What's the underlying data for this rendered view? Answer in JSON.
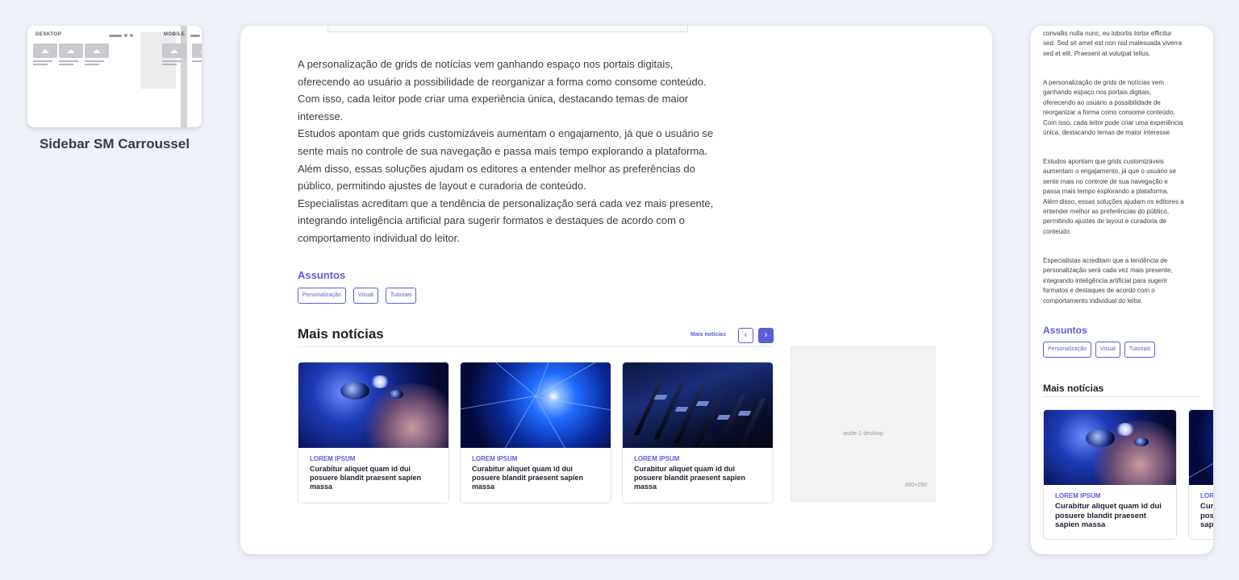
{
  "thumbnail": {
    "desktop_label": "DESKTOP",
    "mobile_label": "MOBILE",
    "caption": "Sidebar SM Carroussel"
  },
  "article": {
    "paragraph": "A personalização de grids de notícias vem ganhando espaço nos portais digitais,\noferecendo ao usuário a possibilidade de reorganizar a forma como consome conteúdo.\nCom isso, cada leitor pode criar uma experiência única, destacando temas de maior\ninteresse.\n Estudos apontam que grids customizáveis aumentam o engajamento, já que o usuário se\nsente mais no controle de sua navegação e passa mais tempo explorando a plataforma.\n Além disso, essas soluções ajudam os editores a entender melhor as preferências do\npúblico, permitindo ajustes de layout e curadoria de conteúdo.\nEspecialistas acreditam que a tendência de personalização será cada vez mais presente,\nintegrando inteligência artificial para sugerir formatos e destaques de acordo com o\ncomportamento individual do leitor."
  },
  "assuntos": {
    "title": "Assuntos",
    "tags": [
      "Personalização",
      "Visual",
      "Tutoriais"
    ]
  },
  "mais_noticias": {
    "title": "Mais notícias",
    "link": "Mais notícias",
    "prev_icon": "‹",
    "next_icon": "›",
    "cards": [
      {
        "category": "LOREM IPSUM",
        "title": "Curabitur aliquet quam id dui posuere blandit praesent sapien massa"
      },
      {
        "category": "LOREM IPSUM",
        "title": "Curabitur aliquet quam id dui posuere blandit praesent sapien massa"
      },
      {
        "category": "LOREM IPSUM",
        "title": "Curabitur aliquet quam id dui posuere blandit praesent sapien massa"
      }
    ]
  },
  "aside": {
    "name": "aside-1-desktop",
    "size": "300×250"
  },
  "mobile": {
    "para0": "convallis nulla nunc, eu lobortis tortor efficitur\nsed. Sed sit amet est non nisl malesuada viverra\nsed et elit. Praesent at volutpat tellus.",
    "para1": "A personalização de grids de notícias vem\nganhando espaço nos portais digitais,\noferecendo ao usuário a possibilidade de\nreorganizar a forma como consome conteúdo.\nCom isso, cada leitor pode criar uma experiência\núnica, destacando temas de maior interesse.",
    "para2": "Estudos apontam que grids customizáveis\naumentam o engajamento, já que o usuário se\nsente mais no controle de sua navegação e\npassa mais tempo explorando a plataforma.\n Além disso, essas soluções ajudam os editores a\nentender melhor as preferências do público,\npermitindo ajustes de layout e curadoria de\nconteúdo.",
    "para3": "Especialistas acreditam que a tendência de\npersonalização será cada vez mais presente,\nintegrando inteligência artificial para sugerir\nformatos e destaques de acordo com o\ncomportamento individual do leitor.",
    "assuntos_title": "Assuntos",
    "tags": [
      "Personalização",
      "Visual",
      "Tutoriais"
    ],
    "mais_title": "Mais notícias",
    "cards": [
      {
        "category": "LOREM IPSUM",
        "title": "Curabitur aliquet quam id dui posuere blandit praesent sapien massa"
      },
      {
        "category": "LOREM IPSUM",
        "title": "Curabitur aliquet quam id dui posuere blandit praesent sapien massa"
      }
    ]
  },
  "colors": {
    "accent": "#5a5ed8",
    "background": "#eff1f8"
  }
}
